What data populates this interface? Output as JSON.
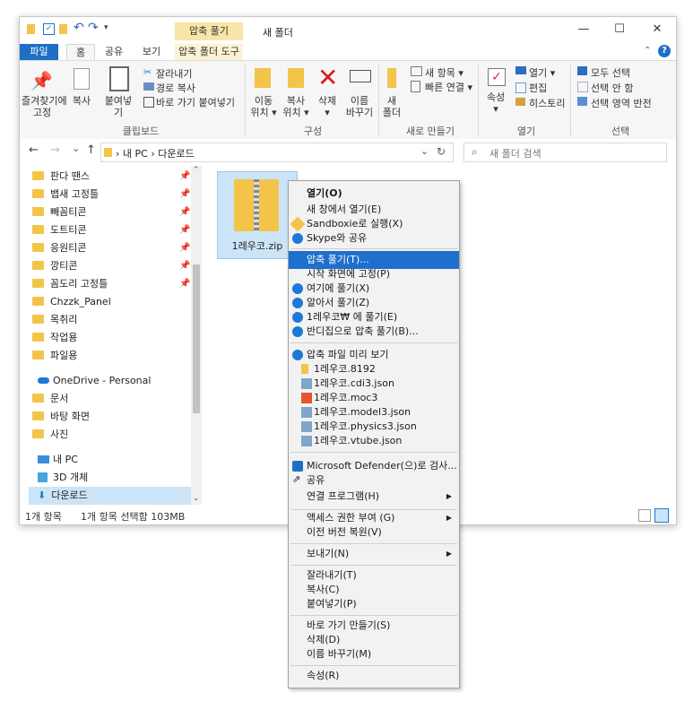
{
  "window": {
    "title": "새 폴더",
    "context_tab_title": "압축 풀기",
    "minimize": "—",
    "maximize": "☐",
    "close": "✕"
  },
  "ribbon_tabs": {
    "file": "파일",
    "home": "홈",
    "share": "공유",
    "view": "보기",
    "tools": "압축 폴더 도구"
  },
  "ribbon": {
    "clipboard": {
      "pin": "즐겨찾기에\n고정",
      "copy": "복사",
      "paste": "붙여넣기",
      "cut": "잘라내기",
      "copy_path": "경로 복사",
      "paste_shortcut": "바로 가기 붙여넣기",
      "label": "클립보드"
    },
    "organize": {
      "move_to": "이동\n위치 ▾",
      "copy_to": "복사\n위치 ▾",
      "delete": "삭제\n▾",
      "rename": "이름\n바꾸기",
      "label": "구성"
    },
    "new": {
      "new_folder": "새\n폴더",
      "new_item": "새 항목 ▾",
      "easy_access": "빠른 연결 ▾",
      "label": "새로 만들기"
    },
    "open": {
      "properties": "속성\n▾",
      "open": "열기 ▾",
      "edit": "편집",
      "history": "히스토리",
      "label": "열기"
    },
    "select": {
      "select_all": "모두 선택",
      "select_none": "선택 안 함",
      "invert": "선택 영역 반전",
      "label": "선택"
    }
  },
  "address": {
    "back": "←",
    "forward": "→",
    "recent": "⌄",
    "up": "↑",
    "path": "› 내 PC › 다운로드",
    "refresh": "↻",
    "dropdown": "⌄",
    "search_placeholder": "새 폴더 검색"
  },
  "nav_items": [
    {
      "label": "판다 땐스",
      "pinned": true
    },
    {
      "label": "뱁새 고정틀",
      "pinned": true
    },
    {
      "label": "빼꼼티콘",
      "pinned": true
    },
    {
      "label": "도트티콘",
      "pinned": true
    },
    {
      "label": "응원티콘",
      "pinned": true
    },
    {
      "label": "깡티콘",
      "pinned": true
    },
    {
      "label": "꼼도리 고정틀",
      "pinned": true
    },
    {
      "label": "Chzzk_Panel",
      "pinned": false
    },
    {
      "label": "목취리",
      "pinned": false
    },
    {
      "label": "작업용",
      "pinned": false
    },
    {
      "label": "파일용",
      "pinned": false
    }
  ],
  "nav_onedrive": "OneDrive - Personal",
  "nav_onedrive_items": [
    "문서",
    "바탕 화면",
    "사진"
  ],
  "nav_pc": "내 PC",
  "nav_pc_items": [
    "3D 개체",
    "다운로드"
  ],
  "file": {
    "name": "1레우코.zip"
  },
  "status": {
    "count": "1개 항목",
    "selected": "1개 항목 선택함 103MB"
  },
  "context_menu": {
    "open": "열기(O)",
    "open_new_window": "새 창에서 열기(E)",
    "sandboxie": "Sandboxie로 실행(X)",
    "skype": "Skype와 공유",
    "extract": "압축 풀기(T)...",
    "pin_start": "시작 화면에 고정(P)",
    "extract_here": "여기에 풀기(X)",
    "extract_smart": "알아서 풀기(Z)",
    "extract_to": "1레우코₩ 에 풀기(E)",
    "bandizip_extract": "반디집으로 압축 풀기(B)...",
    "preview": "압축 파일 미리 보기",
    "preview_items": [
      "1레우코.8192",
      "1레우코.cdi3.json",
      "1레우코.moc3",
      "1레우코.model3.json",
      "1레우코.physics3.json",
      "1레우코.vtube.json"
    ],
    "defender": "Microsoft Defender(으)로 검사...",
    "share": "공유",
    "open_with": "연결 프로그램(H)",
    "grant_access": "액세스 권한 부여 (G)",
    "restore": "이전 버전 복원(V)",
    "send_to": "보내기(N)",
    "cut": "잘라내기(T)",
    "copy": "복사(C)",
    "paste": "붙여넣기(P)",
    "create_shortcut": "바로 가기 만들기(S)",
    "delete": "삭제(D)",
    "rename": "이름 바꾸기(M)",
    "properties": "속성(R)",
    "submenu_arrow": "▶"
  }
}
